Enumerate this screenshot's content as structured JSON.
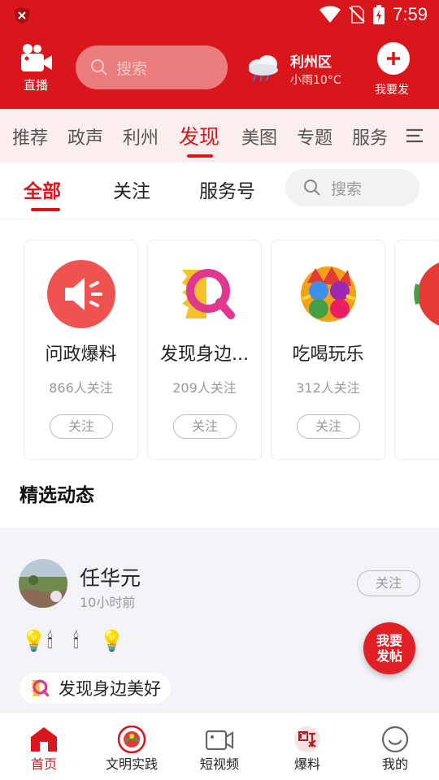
{
  "status_bar": {
    "time": "7:59"
  },
  "header": {
    "live_label": "直播",
    "search_placeholder": "搜索",
    "weather_location": "利州区",
    "weather_desc": "小雨10°C",
    "post_label": "我要发"
  },
  "channels": [
    "推荐",
    "政声",
    "利州",
    "发现",
    "美图",
    "专题",
    "服务"
  ],
  "active_channel": "发现",
  "subtabs": {
    "all": "全部",
    "follow": "关注",
    "service": "服务号",
    "search_placeholder": "搜索"
  },
  "topics": [
    {
      "title": "问政爆料",
      "follows": "866人关注",
      "button": "关注",
      "icon": "speaker-icon"
    },
    {
      "title": "发现身边...",
      "follows": "209人关注",
      "button": "关注",
      "icon": "discover-icon"
    },
    {
      "title": "吃喝玩乐",
      "follows": "312人关注",
      "button": "关注",
      "icon": "eat-drink-play-logo"
    }
  ],
  "section_title": "精选动态",
  "post": {
    "author": "任华元",
    "time_ago": "10小时前",
    "follow_label": "关注",
    "emojis": [
      "💡",
      "🕯",
      "🕯",
      "💡"
    ],
    "topic_tag": "发现身边美好"
  },
  "fab_label": "我要发帖",
  "bottom_nav": [
    {
      "label": "首页",
      "icon": "home-icon",
      "active": true
    },
    {
      "label": "文明实践",
      "icon": "civilization-icon",
      "active": false
    },
    {
      "label": "短视频",
      "icon": "video-icon",
      "active": false
    },
    {
      "label": "爆料",
      "icon": "report-icon",
      "active": false
    },
    {
      "label": "我的",
      "icon": "profile-icon",
      "active": false
    }
  ],
  "colors": {
    "brand_red": "#d8161b",
    "channel_bg": "#fbeeee",
    "feed_bg": "#f3f4f8"
  }
}
